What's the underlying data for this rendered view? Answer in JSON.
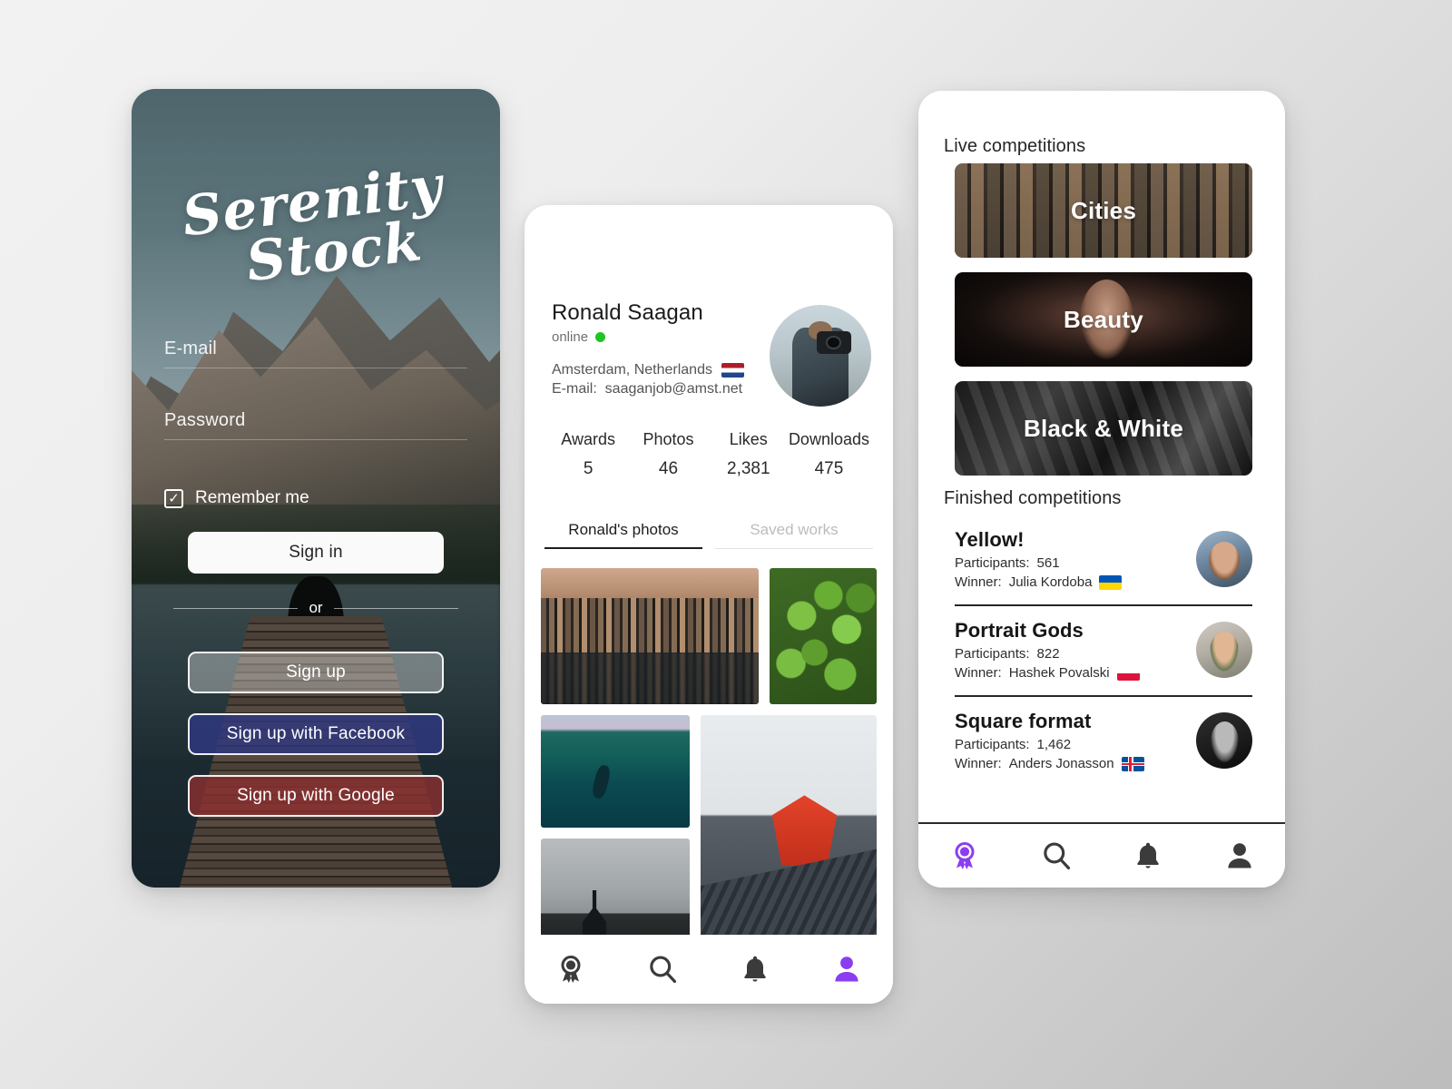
{
  "login": {
    "logo_line1": "Serenity",
    "logo_line2": "Stock",
    "email_label": "E-mail",
    "password_label": "Password",
    "remember_label": "Remember me",
    "checkbox_glyph": "✓",
    "signin_label": "Sign in",
    "or_label": "or",
    "signup_label": "Sign up",
    "facebook_label": "Sign up with Facebook",
    "google_label": "Sign up with Google",
    "facebook_color": "#303882",
    "google_color": "#8c3030"
  },
  "profile": {
    "name": "Ronald Saagan",
    "status": "online",
    "status_color": "#21c521",
    "location": "Amsterdam, Netherlands",
    "location_flag": "netherlands-flag",
    "email_prefix": "E-mail:",
    "email": "saaganjob@amst.net",
    "stats": [
      {
        "label": "Awards",
        "value": "5"
      },
      {
        "label": "Photos",
        "value": "46"
      },
      {
        "label": "Likes",
        "value": "2,381"
      },
      {
        "label": "Downloads",
        "value": "475"
      }
    ],
    "tabs": [
      {
        "label": "Ronald's photos",
        "active": true
      },
      {
        "label": "Saved works",
        "active": false
      }
    ],
    "photos": [
      {
        "name": "amsterdam-canal-houses"
      },
      {
        "name": "aerial-green-trees"
      },
      {
        "name": "underwater-swimmer"
      },
      {
        "name": "red-pagoda-temple"
      },
      {
        "name": "black-church-fog"
      }
    ],
    "nav": [
      {
        "name": "awards-icon",
        "active": false
      },
      {
        "name": "search-icon",
        "active": false
      },
      {
        "name": "bell-icon",
        "active": false
      },
      {
        "name": "profile-icon",
        "active": true
      }
    ],
    "active_color": "#8b3ef0"
  },
  "competitions": {
    "live_title": "Live competitions",
    "live": [
      {
        "label": "Cities",
        "theme": "cities-photo"
      },
      {
        "label": "Beauty",
        "theme": "beauty-photo"
      },
      {
        "label": "Black & White",
        "theme": "black-white-photo"
      }
    ],
    "finished_title": "Finished competitions",
    "finished": [
      {
        "name": "Yellow!",
        "participants_label": "Participants:",
        "participants": "561",
        "winner_label": "Winner:",
        "winner": "Julia Kordoba",
        "winner_flag": "ukraine-flag",
        "avatar": "julia-avatar"
      },
      {
        "name": "Portrait Gods",
        "participants_label": "Participants:",
        "participants": "822",
        "winner_label": "Winner:",
        "winner": "Hashek Povalski",
        "winner_flag": "poland-flag",
        "avatar": "hashek-avatar"
      },
      {
        "name": "Square format",
        "participants_label": "Participants:",
        "participants": "1,462",
        "winner_label": "Winner:",
        "winner": "Anders Jonasson",
        "winner_flag": "iceland-flag",
        "avatar": "anders-avatar"
      }
    ],
    "nav": [
      {
        "name": "awards-icon",
        "active": true
      },
      {
        "name": "search-icon",
        "active": false
      },
      {
        "name": "bell-icon",
        "active": false
      },
      {
        "name": "profile-icon",
        "active": false
      }
    ],
    "active_color": "#8b3ef0"
  }
}
